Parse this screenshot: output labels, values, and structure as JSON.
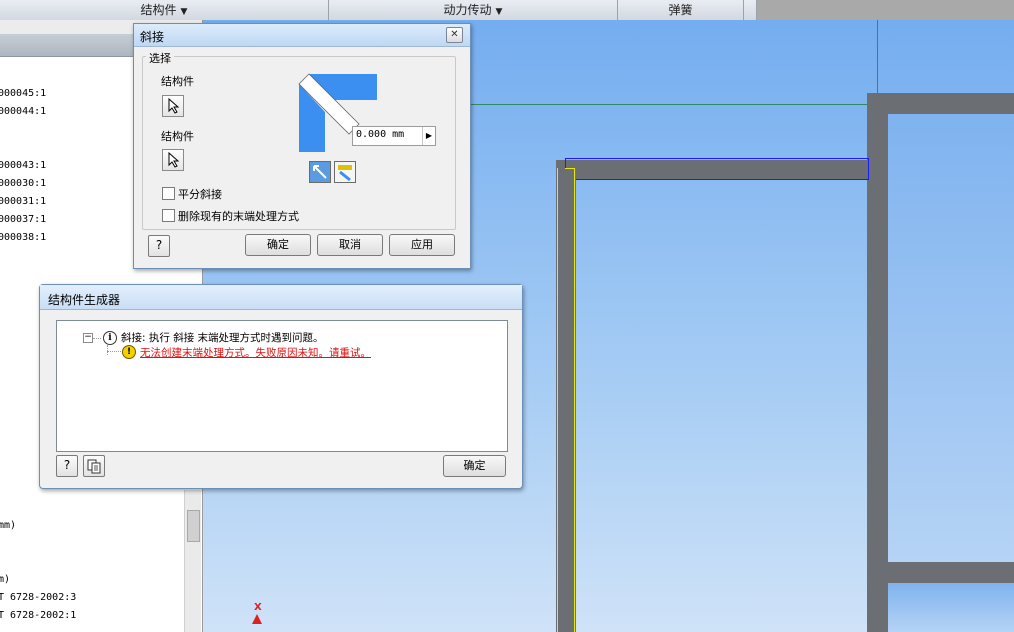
{
  "ribbon": {
    "panels": [
      {
        "label": "结构件"
      },
      {
        "label": "动力传动"
      },
      {
        "label": "弹簧"
      }
    ]
  },
  "browser": {
    "top_items": [
      "000045:1",
      "000044:1",
      "000043:1",
      "000030:1",
      "000031:1",
      "000037:1",
      "000038:1"
    ],
    "bottom_items": [
      "mm)",
      "m)",
      "T 6728-2002:3",
      "T 6728-2002:1"
    ]
  },
  "miter_dialog": {
    "title": "斜接",
    "group_label": "选择",
    "member1_label": "结构件",
    "member2_label": "结构件",
    "offset_value": "0.000 mm",
    "bisect_label": "平分斜接",
    "delete_label": "删除现有的末端处理方式",
    "ok_label": "确定",
    "cancel_label": "取消",
    "apply_label": "应用",
    "help_glyph": "?",
    "close_glyph": "✕"
  },
  "generator_dialog": {
    "title": "结构件生成器",
    "message_info": "斜接: 执行 斜接 末端处理方式时遇到问题。",
    "message_error": "无法创建末端处理方式。失败原因未知。请重试。",
    "ok_label": "确定",
    "help_glyph": "?"
  },
  "viewport": {
    "axis_label": "X"
  },
  "colors": {
    "accent_blue": "#3a8ff0",
    "error_red": "#e01010",
    "selection_blue": "#1a1aff"
  }
}
